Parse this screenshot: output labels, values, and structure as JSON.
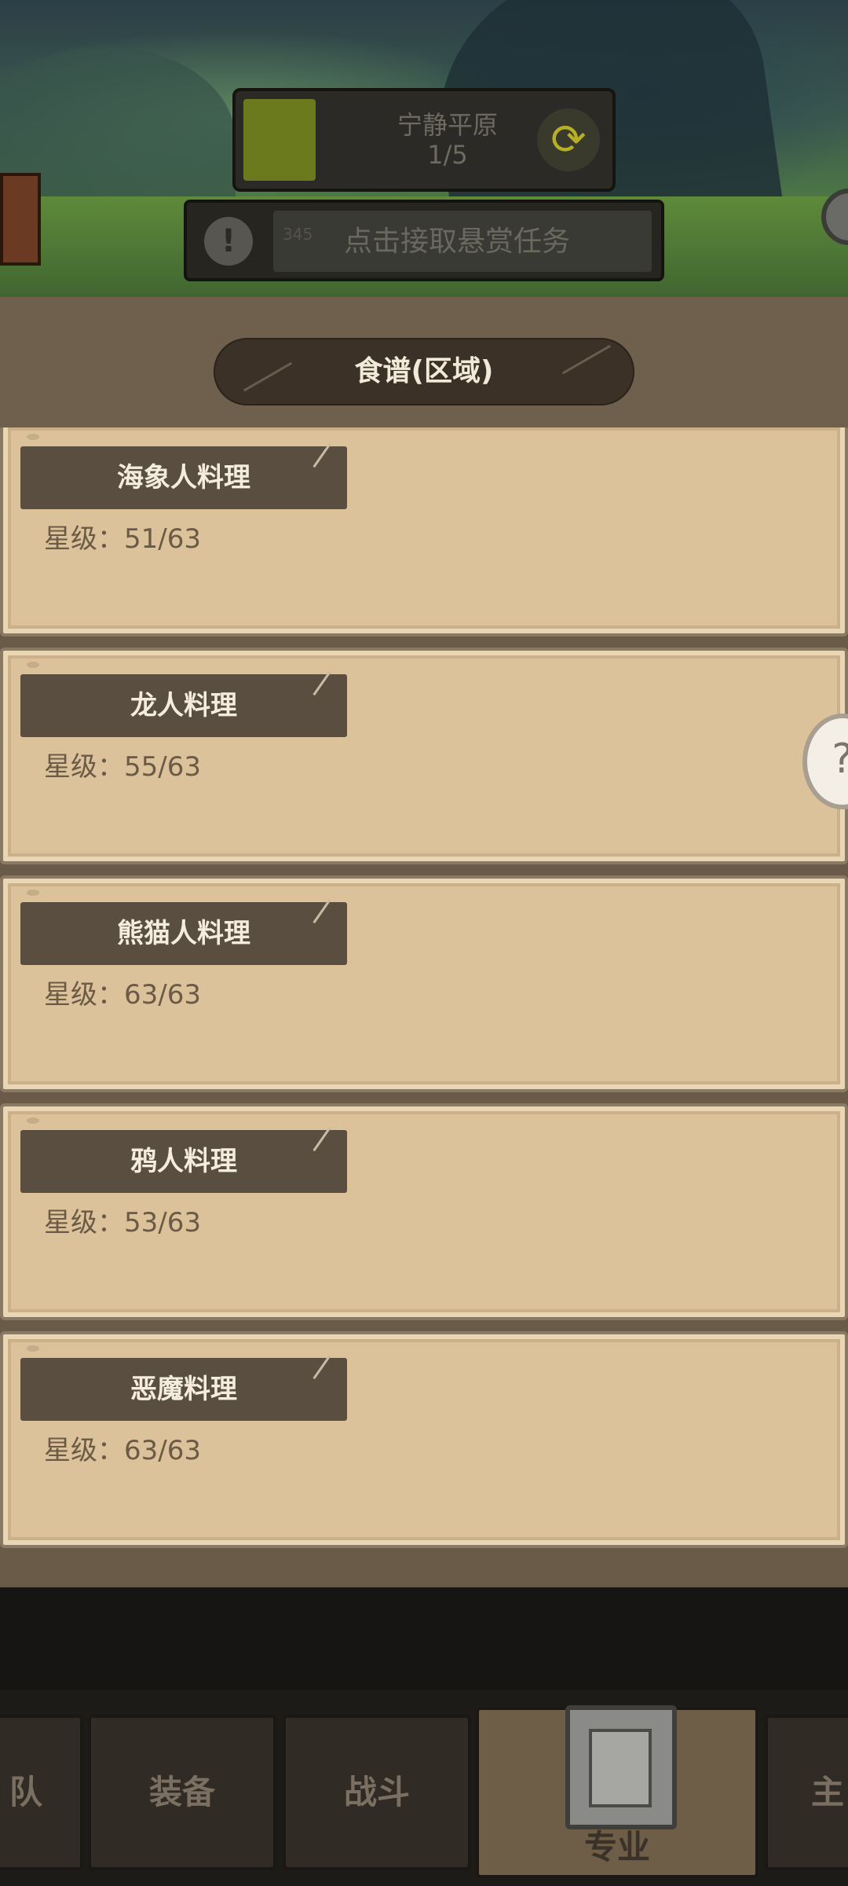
{
  "hud": {
    "region_name": "宁静平原",
    "region_progress": "1/5",
    "bounty_number": "345",
    "bounty_text": "点击接取悬赏任务"
  },
  "panel": {
    "title": "食谱(区域)"
  },
  "recipes": [
    {
      "name": "海象人料理",
      "stars": "星级：51/63"
    },
    {
      "name": "龙人料理",
      "stars": "星级：55/63"
    },
    {
      "name": "熊猫人料理",
      "stars": "星级：63/63"
    },
    {
      "name": "鸦人料理",
      "stars": "星级：53/63"
    },
    {
      "name": "恶魔料理",
      "stars": "星级：63/63"
    }
  ],
  "nav": {
    "tabs": [
      {
        "label": "队"
      },
      {
        "label": "装备"
      },
      {
        "label": "战斗"
      },
      {
        "label": "专业"
      },
      {
        "label": "主"
      }
    ],
    "active_index": 3
  },
  "colors": {
    "card_bg": "#dcc29a",
    "tag_bg": "#5a4e40",
    "panel_bg": "#6a5a48"
  }
}
